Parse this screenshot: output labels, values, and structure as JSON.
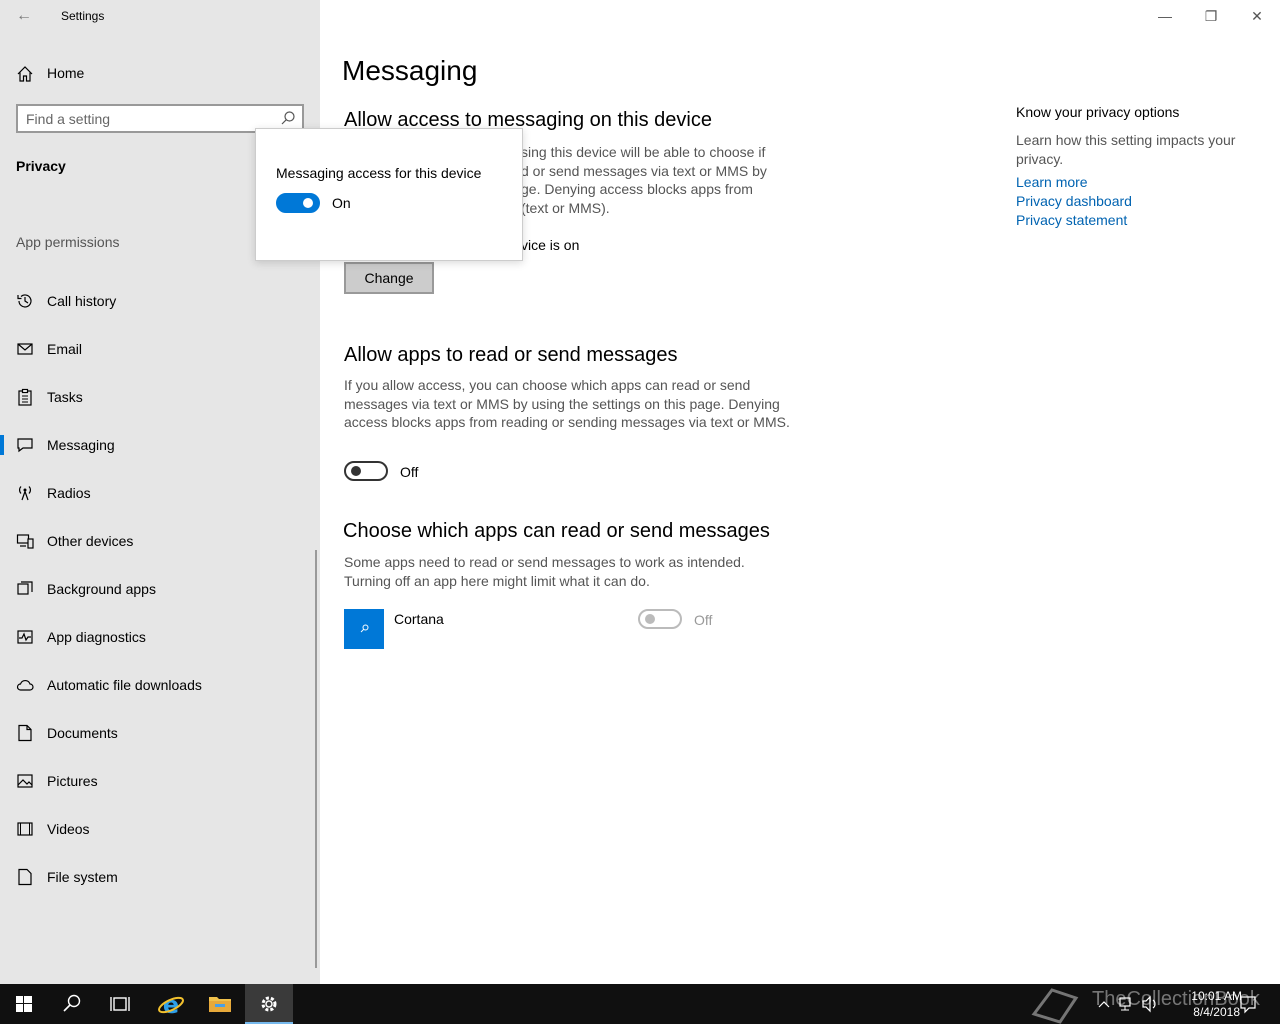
{
  "window": {
    "title": "Settings",
    "controls": {
      "minimize": "—",
      "restore": "❐",
      "close": "✕"
    }
  },
  "sidebar": {
    "home_label": "Home",
    "search_placeholder": "Find a setting",
    "section_title": "Privacy",
    "group_label": "App permissions",
    "items": [
      {
        "label": "Call history",
        "icon": "history-icon"
      },
      {
        "label": "Email",
        "icon": "mail-icon"
      },
      {
        "label": "Tasks",
        "icon": "clipboard-icon"
      },
      {
        "label": "Messaging",
        "icon": "chat-icon",
        "active": true
      },
      {
        "label": "Radios",
        "icon": "radio-tower-icon"
      },
      {
        "label": "Other devices",
        "icon": "devices-icon"
      },
      {
        "label": "Background apps",
        "icon": "background-apps-icon"
      },
      {
        "label": "App diagnostics",
        "icon": "diagnostics-icon"
      },
      {
        "label": "Automatic file downloads",
        "icon": "cloud-icon"
      },
      {
        "label": "Documents",
        "icon": "document-icon"
      },
      {
        "label": "Pictures",
        "icon": "picture-icon"
      },
      {
        "label": "Videos",
        "icon": "video-icon"
      },
      {
        "label": "File system",
        "icon": "file-icon"
      }
    ]
  },
  "main": {
    "title": "Messaging",
    "section1": {
      "heading": "Allow access to messaging on this device",
      "desc_lines": [
        "sing this device will be able to choose if",
        "d or send messages via text or MMS by",
        "ge. Denying access blocks apps from",
        "(text or MMS)."
      ],
      "status": "vice is on",
      "change_label": "Change"
    },
    "section2": {
      "heading": "Allow apps to read or send messages",
      "desc": "If you allow access, you can choose which apps can read or send messages via text or MMS by using the settings on this page. Denying access blocks apps from reading or sending messages via text or MMS.",
      "toggle_state": "Off"
    },
    "section3": {
      "heading": "Choose which apps can read or send messages",
      "desc": "Some apps need to read or send messages to work as intended. Turning off an app here might limit what it can do.",
      "apps": [
        {
          "name": "Cortana",
          "state": "Off"
        }
      ]
    }
  },
  "right_pane": {
    "title": "Know your privacy options",
    "desc": "Learn how this setting impacts your privacy.",
    "links": [
      "Learn more",
      "Privacy dashboard",
      "Privacy statement"
    ]
  },
  "flyout": {
    "title": "Messaging access for this device",
    "toggle_state": "On"
  },
  "taskbar": {
    "time": "10:01 AM",
    "date": "8/4/2018",
    "watermark": "TheCollectionBook",
    "accent": "#0078d7"
  }
}
